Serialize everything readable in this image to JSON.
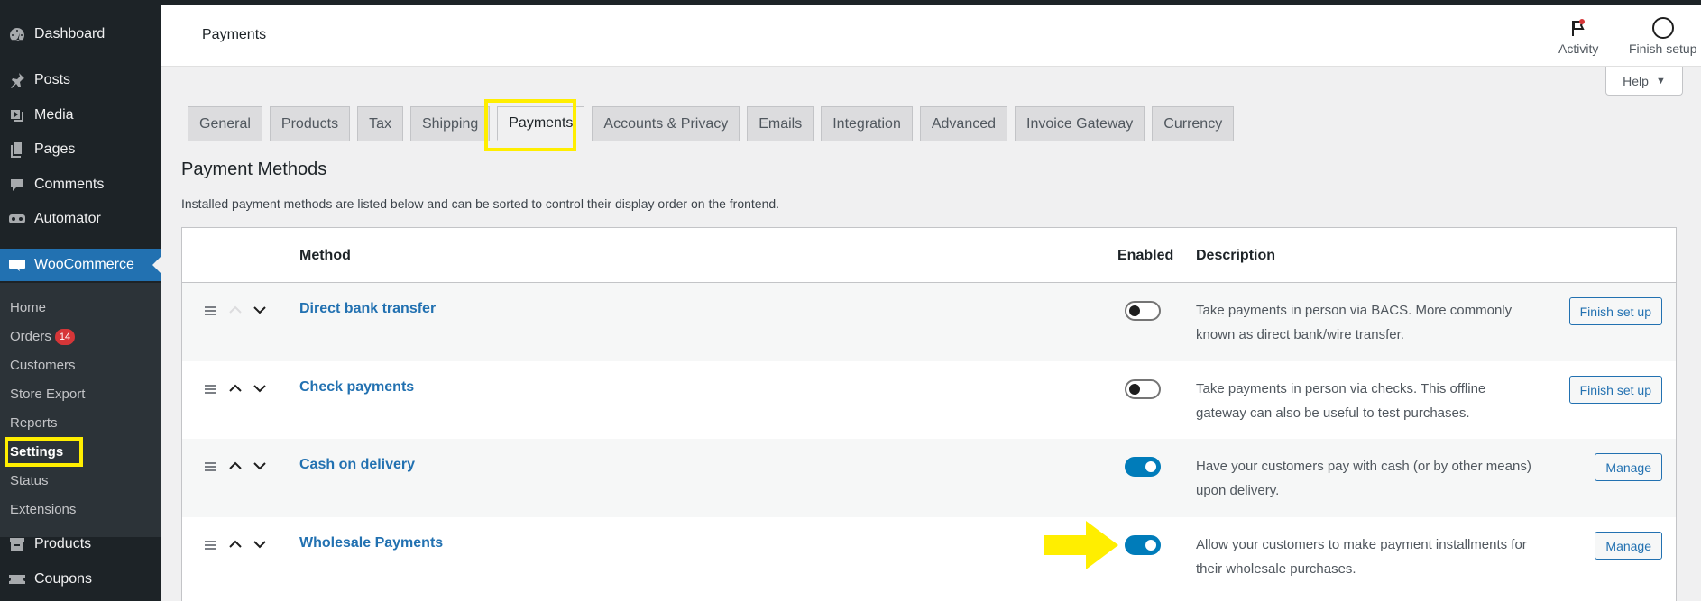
{
  "sidebar": {
    "top_items": [
      {
        "label": "Dashboard",
        "icon": "dashboard-icon"
      },
      {
        "label": "Posts",
        "icon": "pin-icon"
      },
      {
        "label": "Media",
        "icon": "media-icon"
      },
      {
        "label": "Pages",
        "icon": "pages-icon"
      },
      {
        "label": "Comments",
        "icon": "comment-icon"
      },
      {
        "label": "Automator",
        "icon": "automator-icon"
      },
      {
        "label": "WooCommerce",
        "icon": "woo-icon"
      }
    ],
    "sub_items": [
      "Home",
      "Orders",
      "Customers",
      "Store Export",
      "Reports",
      "Settings",
      "Status",
      "Extensions"
    ],
    "orders_count": "14",
    "bottom_items": [
      {
        "label": "Products",
        "icon": "archive-icon"
      },
      {
        "label": "Coupons",
        "icon": "ticket-icon"
      }
    ]
  },
  "header": {
    "title": "Payments",
    "activity_label": "Activity",
    "finish_setup_label": "Finish setup",
    "help_label": "Help"
  },
  "tabs": [
    "General",
    "Products",
    "Tax",
    "Shipping",
    "Payments",
    "Accounts & Privacy",
    "Emails",
    "Integration",
    "Advanced",
    "Invoice Gateway",
    "Currency"
  ],
  "active_tab": "Payments",
  "section": {
    "title": "Payment Methods",
    "description": "Installed payment methods are listed below and can be sorted to control their display order on the frontend."
  },
  "table": {
    "headers": {
      "method": "Method",
      "enabled": "Enabled",
      "description": "Description"
    },
    "rows": [
      {
        "name": "Direct bank transfer",
        "enabled": false,
        "description": "Take payments in person via BACS. More commonly known as direct bank/wire transfer.",
        "action": "Finish set up"
      },
      {
        "name": "Check payments",
        "enabled": false,
        "description": "Take payments in person via checks. This offline gateway can also be useful to test purchases.",
        "action": "Finish set up"
      },
      {
        "name": "Cash on delivery",
        "enabled": true,
        "description": "Have your customers pay with cash (or by other means) upon delivery.",
        "action": "Manage"
      },
      {
        "name": "Wholesale Payments",
        "enabled": true,
        "description": "Allow your customers to make payment installments for their wholesale purchases.",
        "action": "Manage"
      }
    ]
  },
  "colors": {
    "sidebar_bg": "#1d2327",
    "accent": "#2271b1",
    "highlight": "#ffee00",
    "toggle_on": "#007cba"
  }
}
